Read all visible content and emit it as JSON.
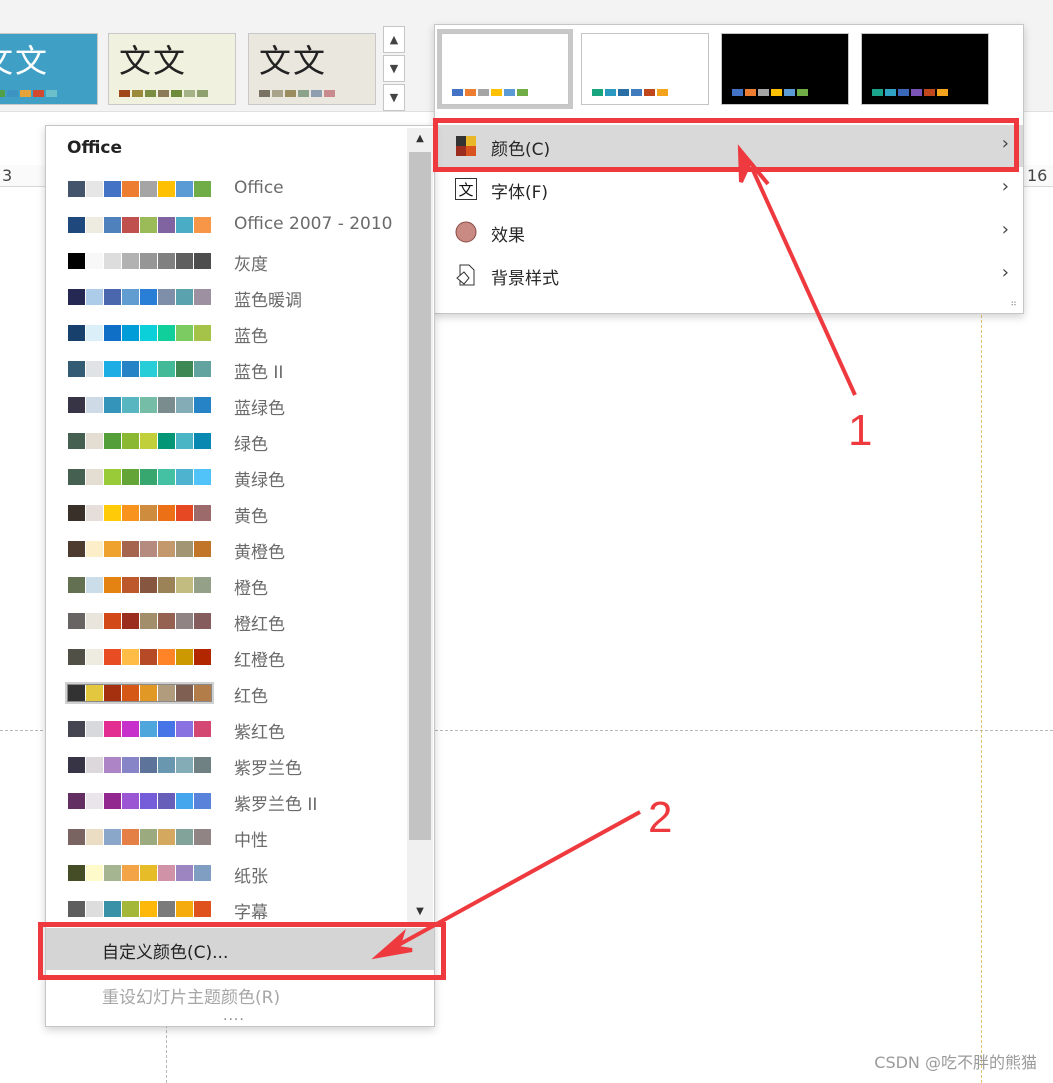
{
  "ribbon": {
    "themes": [
      {
        "glyph": "文文",
        "bg": "#3f9fc5",
        "stripes": [
          "#2b6fb0",
          "#51a047",
          "#3d94c3",
          "#e6a33a",
          "#d14a2f",
          "#6cc0c9"
        ]
      },
      {
        "glyph": "文文",
        "bg": "#f1f1df",
        "stripes": [
          "#a1481b",
          "#9b8a3c",
          "#7a8d43",
          "#8a7a58",
          "#6d8b3b",
          "#a5b288",
          "#8da06d"
        ]
      },
      {
        "glyph": "文文",
        "bg": "#eae7de",
        "stripes": [
          "#7a7363",
          "#a9a38c",
          "#9a8d5f",
          "#8ba28a",
          "#8d9fb0",
          "#c98a8e"
        ]
      }
    ],
    "scroll_up": "▲",
    "scroll_down": "▼",
    "scroll_more": "▼"
  },
  "ruler": {
    "left_num": "3",
    "right_num": "16"
  },
  "variants": [
    {
      "bg": "#ffffff",
      "selected": true,
      "stripes": [
        "#4472c4",
        "#ed7d31",
        "#a5a5a5",
        "#ffc000",
        "#5b9bd5",
        "#70ad47"
      ]
    },
    {
      "bg": "#ffffff",
      "selected": false,
      "stripes": [
        "#18a47c",
        "#2b98c0",
        "#2a6ea6",
        "#3f7bbd",
        "#c0461b",
        "#f4a31c"
      ]
    },
    {
      "bg": "#000000",
      "selected": false,
      "stripes": [
        "#4472c4",
        "#ed7d31",
        "#a5a5a5",
        "#ffc000",
        "#5b9bd5",
        "#70ad47"
      ]
    },
    {
      "bg": "#000000",
      "selected": false,
      "stripes": [
        "#1aa48c",
        "#30a3c5",
        "#3868b7",
        "#7a55b7",
        "#c0461b",
        "#f4a31c"
      ]
    }
  ],
  "menu": [
    {
      "label": "颜色(C)",
      "icon": "color-scheme-icon",
      "highlighted": true
    },
    {
      "label": "字体(F)",
      "icon": "font-icon",
      "highlighted": false
    },
    {
      "label": "效果",
      "icon": "effects-icon",
      "highlighted": false
    },
    {
      "label": "背景样式",
      "icon": "background-style-icon",
      "highlighted": false
    }
  ],
  "chevron": "›",
  "color_list": {
    "heading": "Office",
    "items": [
      {
        "label": "Office",
        "colors": [
          "#44546a",
          "#e7e6e6",
          "#4472c4",
          "#ed7d31",
          "#a5a5a5",
          "#ffc000",
          "#5b9bd5",
          "#70ad47"
        ]
      },
      {
        "label": "Office 2007 - 2010",
        "colors": [
          "#1f497d",
          "#eeece1",
          "#4f81bd",
          "#c0504d",
          "#9bbb59",
          "#8064a2",
          "#4bacc6",
          "#f79646"
        ]
      },
      {
        "label": "灰度",
        "colors": [
          "#000000",
          "#f8f8f8",
          "#dddddd",
          "#b2b2b2",
          "#969696",
          "#808080",
          "#5f5f5f",
          "#4d4d4d"
        ]
      },
      {
        "label": "蓝色暖调",
        "colors": [
          "#242852",
          "#acccea",
          "#4a66ac",
          "#629dd1",
          "#297fd5",
          "#7f8fa9",
          "#5aa2ae",
          "#9d90a0"
        ]
      },
      {
        "label": "蓝色",
        "colors": [
          "#17406d",
          "#dbeff9",
          "#0f6fc6",
          "#009dd9",
          "#0bd0d9",
          "#10cf9b",
          "#7cca62",
          "#a5c249"
        ]
      },
      {
        "label": "蓝色 II",
        "colors": [
          "#335b74",
          "#dfe3e5",
          "#1cade4",
          "#2683c6",
          "#27ced7",
          "#42ba97",
          "#3e8853",
          "#62a39f"
        ]
      },
      {
        "label": "蓝绿色",
        "colors": [
          "#373545",
          "#cedbe6",
          "#3494ba",
          "#58b6c0",
          "#75bda7",
          "#7a8c8e",
          "#84acb6",
          "#2683c6"
        ]
      },
      {
        "label": "绿色",
        "colors": [
          "#455f51",
          "#e3ded1",
          "#549e39",
          "#8ab833",
          "#c0cf3a",
          "#029676",
          "#4ab5c4",
          "#0989b1"
        ]
      },
      {
        "label": "黄绿色",
        "colors": [
          "#455f51",
          "#e3ded1",
          "#99cb38",
          "#63a537",
          "#37a76f",
          "#44c1a3",
          "#4eb3cf",
          "#51c3f9"
        ]
      },
      {
        "label": "黄色",
        "colors": [
          "#39302a",
          "#e5dedb",
          "#ffca08",
          "#f8931d",
          "#ce8d3e",
          "#ec7016",
          "#e64823",
          "#9c6a6a"
        ]
      },
      {
        "label": "黄橙色",
        "colors": [
          "#4e3b30",
          "#fbeec9",
          "#f0a22e",
          "#a5644e",
          "#b58b80",
          "#c3986d",
          "#a19574",
          "#c17529"
        ]
      },
      {
        "label": "橙色",
        "colors": [
          "#637052",
          "#ccddea",
          "#e48312",
          "#bd582c",
          "#865640",
          "#9b8357",
          "#c2bc80",
          "#94a088"
        ]
      },
      {
        "label": "橙红色",
        "colors": [
          "#696464",
          "#e9e5dc",
          "#d34817",
          "#9b2d1f",
          "#a28e6a",
          "#956251",
          "#918485",
          "#855d5d"
        ]
      },
      {
        "label": "红橙色",
        "colors": [
          "#505046",
          "#eeece1",
          "#e84c22",
          "#ffbd47",
          "#b64926",
          "#ff8427",
          "#cc9900",
          "#b22600"
        ]
      },
      {
        "label": "红色",
        "colors": [
          "#323232",
          "#e3c83f",
          "#a5300f",
          "#d55816",
          "#e19825",
          "#b19c7d",
          "#7f5f52",
          "#b27d49"
        ]
      },
      {
        "label": "紫红色",
        "colors": [
          "#454551",
          "#d8d9dc",
          "#e32d91",
          "#c830cc",
          "#4ea6dc",
          "#4775e7",
          "#8971e1",
          "#d54773"
        ]
      },
      {
        "label": "紫罗兰色",
        "colors": [
          "#373545",
          "#dcd8dc",
          "#ad84c6",
          "#8784c7",
          "#5d739a",
          "#6997af",
          "#84acb6",
          "#6f8183"
        ]
      },
      {
        "label": "紫罗兰色 II",
        "colors": [
          "#632e62",
          "#eae5eb",
          "#92278f",
          "#9b57d3",
          "#755dd9",
          "#665eb8",
          "#45a5ed",
          "#5982db"
        ]
      },
      {
        "label": "中性",
        "colors": [
          "#7a6461",
          "#ebddc3",
          "#8aa7c9",
          "#e47f45",
          "#9caa7f",
          "#d4a85f",
          "#82a399",
          "#918485"
        ]
      },
      {
        "label": "纸张",
        "colors": [
          "#444d26",
          "#fefac9",
          "#a5b592",
          "#f3a447",
          "#e7bc29",
          "#d092a7",
          "#9c85c0",
          "#809ec2"
        ]
      },
      {
        "label": "字幕",
        "colors": [
          "#5e5e5e",
          "#dddddd",
          "#3891a7",
          "#a4b739",
          "#feb80a",
          "#7b7b7b",
          "#f5ab0d",
          "#e0521d"
        ]
      }
    ],
    "selected_index": 14,
    "custom_label": "自定义颜色(C)...",
    "reset_label": "重设幻灯片主题颜色(R)",
    "more_dots": "....",
    "scroll_up": "▲",
    "scroll_down": "▼"
  },
  "annotations": {
    "num1": "1",
    "num2": "2",
    "color": "#ee3a3f"
  },
  "watermark": "CSDN @吃不胖的熊猫"
}
